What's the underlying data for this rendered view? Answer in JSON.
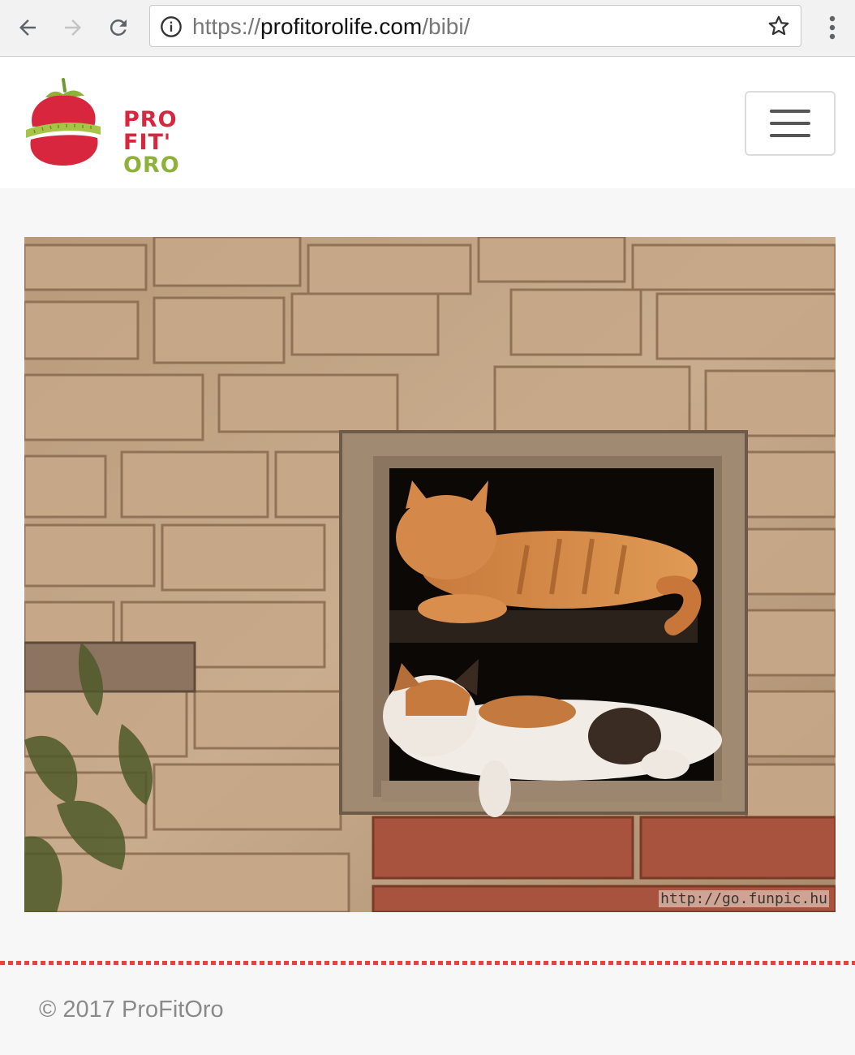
{
  "browser": {
    "url_scheme": "https://",
    "url_host": "profitorolife.com",
    "url_path": "/bibi/",
    "icons": [
      "back-arrow-icon",
      "forward-arrow-icon",
      "reload-icon",
      "info-icon",
      "star-icon",
      "more-vert-icon"
    ]
  },
  "header": {
    "logo_line1": "PRO",
    "logo_line2": "FIT'",
    "logo_line3": "ORO",
    "menu_icon": "hamburger-icon"
  },
  "photo": {
    "watermark": "http://go.funpic.hu"
  },
  "footer": {
    "copyright": "© 2017 ProFitOro"
  },
  "colors": {
    "brand_red": "#d7263d",
    "brand_green": "#8db13a",
    "divider_red": "#e0463f"
  }
}
